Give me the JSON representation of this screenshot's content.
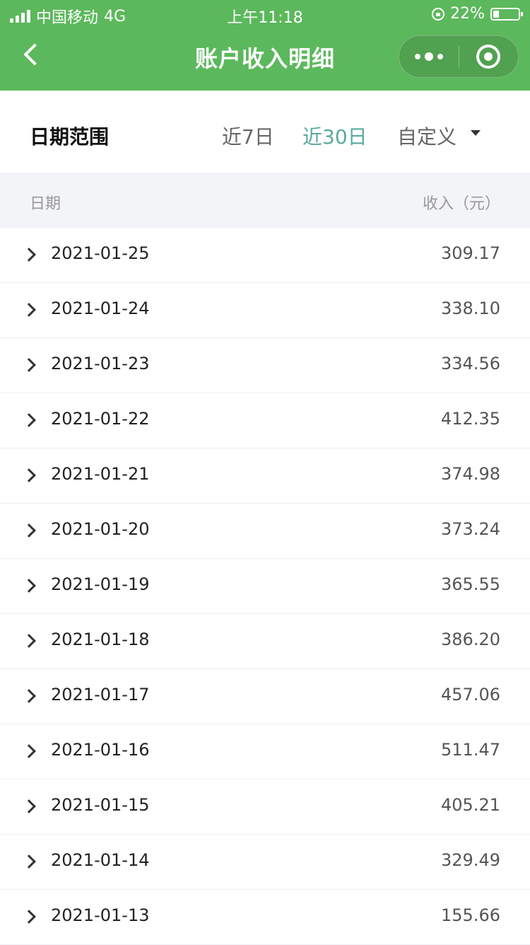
{
  "status_bar": {
    "carrier": "中国移动",
    "network": "4G",
    "time": "上午11:18",
    "battery": "22%"
  },
  "nav": {
    "title": "账户收入明细"
  },
  "filter": {
    "label": "日期范围",
    "options": [
      "近7日",
      "近30日",
      "自定义"
    ],
    "selected": "近30日",
    "accent_color": "#5aa9a0"
  },
  "table": {
    "col_date": "日期",
    "col_income": "收入（元）",
    "rows": [
      {
        "date": "2021-01-25",
        "amount": "309.17"
      },
      {
        "date": "2021-01-24",
        "amount": "338.10"
      },
      {
        "date": "2021-01-23",
        "amount": "334.56"
      },
      {
        "date": "2021-01-22",
        "amount": "412.35"
      },
      {
        "date": "2021-01-21",
        "amount": "374.98"
      },
      {
        "date": "2021-01-20",
        "amount": "373.24"
      },
      {
        "date": "2021-01-19",
        "amount": "365.55"
      },
      {
        "date": "2021-01-18",
        "amount": "386.20"
      },
      {
        "date": "2021-01-17",
        "amount": "457.06"
      },
      {
        "date": "2021-01-16",
        "amount": "511.47"
      },
      {
        "date": "2021-01-15",
        "amount": "405.21"
      },
      {
        "date": "2021-01-14",
        "amount": "329.49"
      },
      {
        "date": "2021-01-13",
        "amount": "155.66"
      }
    ]
  },
  "colors": {
    "header_green": "#5cb85c"
  }
}
